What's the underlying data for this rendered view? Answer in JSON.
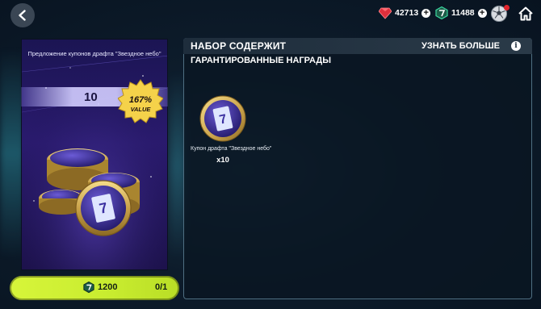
{
  "topbar": {
    "gems": "42713",
    "coins": "11488"
  },
  "offer": {
    "title": "Предложение купонов драфта \"Звездное небо\"",
    "quantity": "10",
    "value_percent": "167%",
    "value_word": "VALUE"
  },
  "buy": {
    "price": "1200",
    "limit": "0/1"
  },
  "panel": {
    "title": "НАБОР СОДЕРЖИТ",
    "learn_more": "УЗНАТЬ БОЛЬШЕ",
    "section": "ГАРАНТИРОВАННЫЕ НАГРАДЫ",
    "rewards": [
      {
        "name": "Купон драфта \"Звездное небо\"",
        "quantity": "x10"
      }
    ]
  },
  "colors": {
    "buy_button": "#d7f53a",
    "gem_red": "#e0303c",
    "coin_green": "#3bd6a0",
    "gold": "#e7c36a"
  }
}
